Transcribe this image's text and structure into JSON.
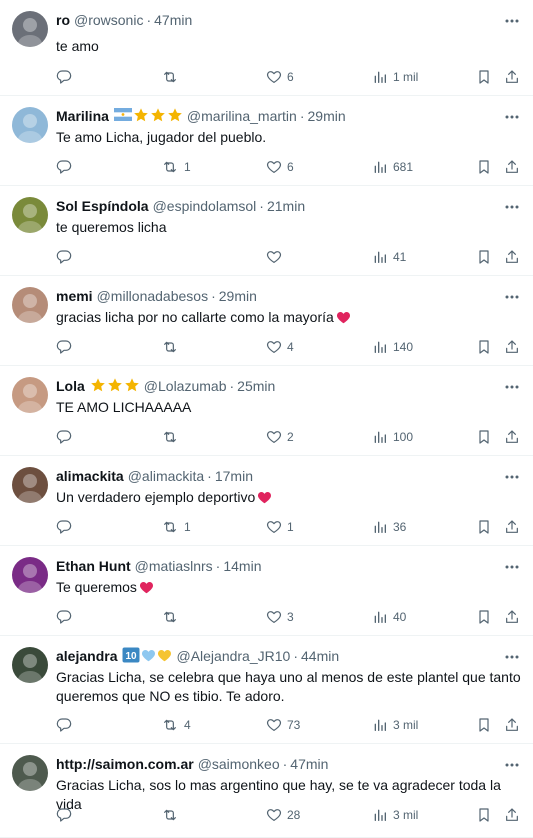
{
  "tweets": [
    {
      "name": "ro",
      "handle": "@rowsonic",
      "sep": "·",
      "time": "47min",
      "text": "te amo",
      "replies": "",
      "retweets": "",
      "likes": "6",
      "views": "1 mil",
      "badges": [],
      "heart": false
    },
    {
      "name": "Marilina",
      "handle": "@marilina_martin",
      "sep": "·",
      "time": "29min",
      "text": "Te amo Licha, jugador del pueblo.",
      "replies": "",
      "retweets": "1",
      "likes": "6",
      "views": "681",
      "badges": [
        "argentina-flag",
        "star",
        "star",
        "star"
      ],
      "heart": false
    },
    {
      "name": "Sol Espíndola",
      "handle": "@espindolamsol",
      "sep": "·",
      "time": "21min",
      "text": "te queremos licha",
      "replies": "",
      "retweets": "",
      "likes": "",
      "views": "41",
      "badges": [],
      "heart": false,
      "no_retweet": true
    },
    {
      "name": "memi",
      "handle": "@millonadabesos",
      "sep": "·",
      "time": "29min",
      "text": "gracias licha por no callarte como la mayoría",
      "replies": "",
      "retweets": "",
      "likes": "4",
      "views": "140",
      "badges": [],
      "heart": true
    },
    {
      "name": "Lola",
      "handle": "@Lolazumab",
      "sep": "·",
      "time": "25min",
      "text": "TE AMO LICHAAAAA",
      "replies": "",
      "retweets": "",
      "likes": "2",
      "views": "100",
      "badges": [
        "star",
        "star",
        "star"
      ],
      "heart": false
    },
    {
      "name": "alimackita",
      "handle": "@alimackita",
      "sep": "·",
      "time": "17min",
      "text": "Un verdadero ejemplo deportivo",
      "replies": "",
      "retweets": "1",
      "likes": "1",
      "views": "36",
      "badges": [],
      "heart": true
    },
    {
      "name": "Ethan Hunt",
      "handle": "@matiaslnrs",
      "sep": "·",
      "time": "14min",
      "text": "Te queremos",
      "replies": "",
      "retweets": "",
      "likes": "3",
      "views": "40",
      "badges": [],
      "heart": true
    },
    {
      "name": "alejandra",
      "handle": "@Alejandra_JR10",
      "sep": "·",
      "time": "44min",
      "text": "Gracias Licha, se celebra que haya uno al menos de este plantel que tanto queremos que NO es tibio. Te adoro.",
      "replies": "",
      "retweets": "4",
      "likes": "73",
      "views": "3 mil",
      "badges": [
        "keycap-10",
        "blue-heart",
        "yellow-heart"
      ],
      "heart": false
    },
    {
      "name": "http://saimon.com.ar",
      "handle": "@saimonkeo",
      "sep": "·",
      "time": "47min",
      "text": "Gracias Licha, sos lo mas argentino que hay, se te va agradecer toda la vida",
      "replies": "",
      "retweets": "",
      "likes": "28",
      "views": "3 mil",
      "badges": [],
      "heart": false
    }
  ],
  "colors": {
    "text": "#0f1419",
    "secondary": "#536471",
    "divider": "#eff3f4",
    "star": "#f4b400",
    "heart_red": "#e0245e"
  },
  "icons": {
    "reply": "reply-icon",
    "retweet": "retweet-icon",
    "like": "like-icon",
    "views": "views-icon",
    "bookmark": "bookmark-icon",
    "share": "share-icon",
    "more": "more-icon"
  }
}
